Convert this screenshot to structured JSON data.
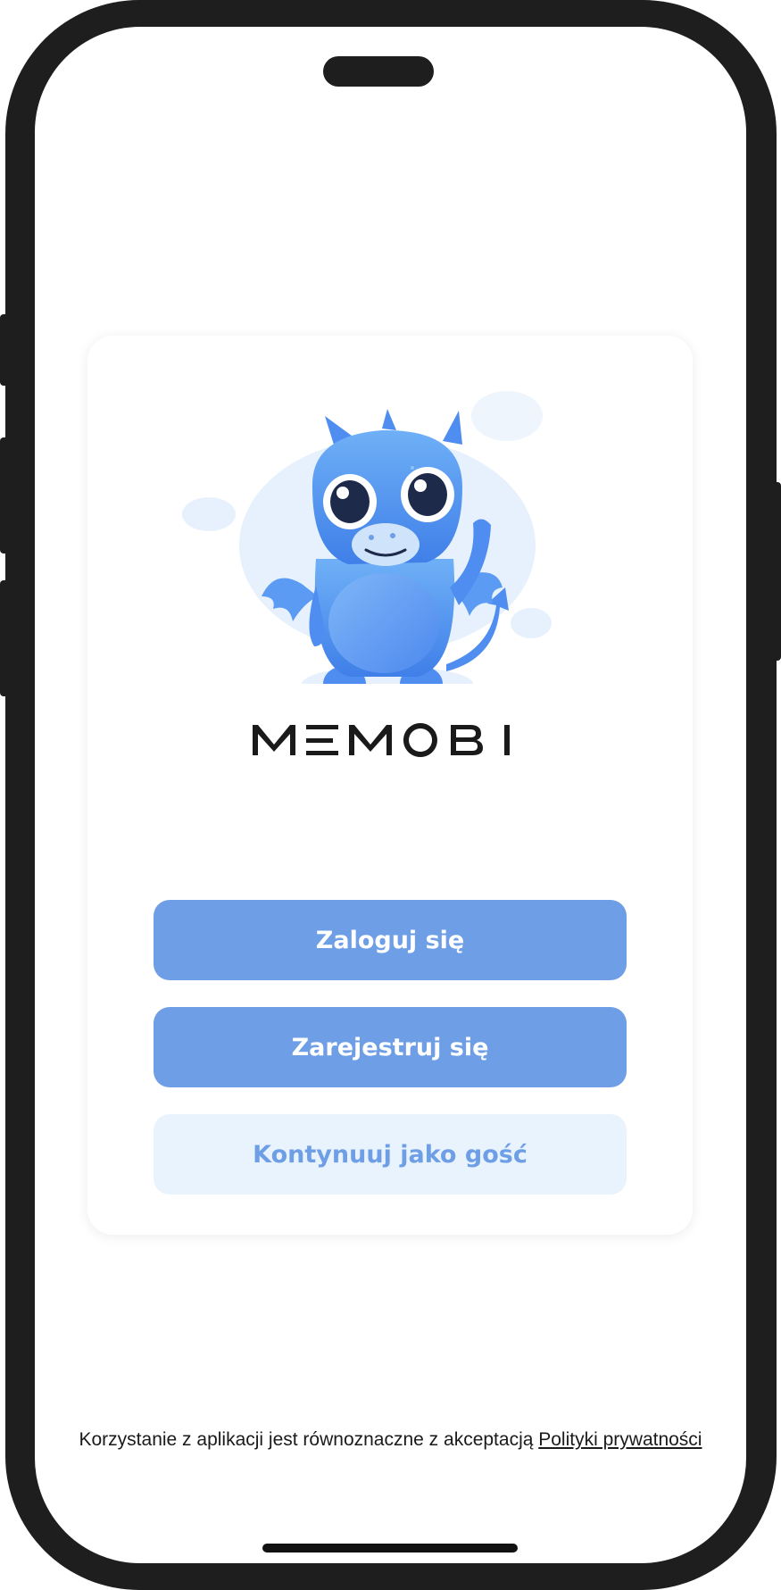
{
  "app": {
    "brand_logo_text": "MEMOBI"
  },
  "auth": {
    "login_label": "Zaloguj się",
    "register_label": "Zarejestruj się",
    "guest_label": "Kontynuuj jako gość"
  },
  "footer": {
    "consent_text": "Korzystanie z aplikacji jest równoznaczne z akceptacją ",
    "privacy_link": "Polityki prywatności"
  },
  "colors": {
    "primary_button": "#6e9fe6",
    "secondary_button": "#e8f3fd",
    "mascot_blue": "#4f8ef0",
    "phone_frame": "#1e1e1e"
  },
  "icons": {
    "mascot": "blue-dragon-mascot-illustration"
  }
}
